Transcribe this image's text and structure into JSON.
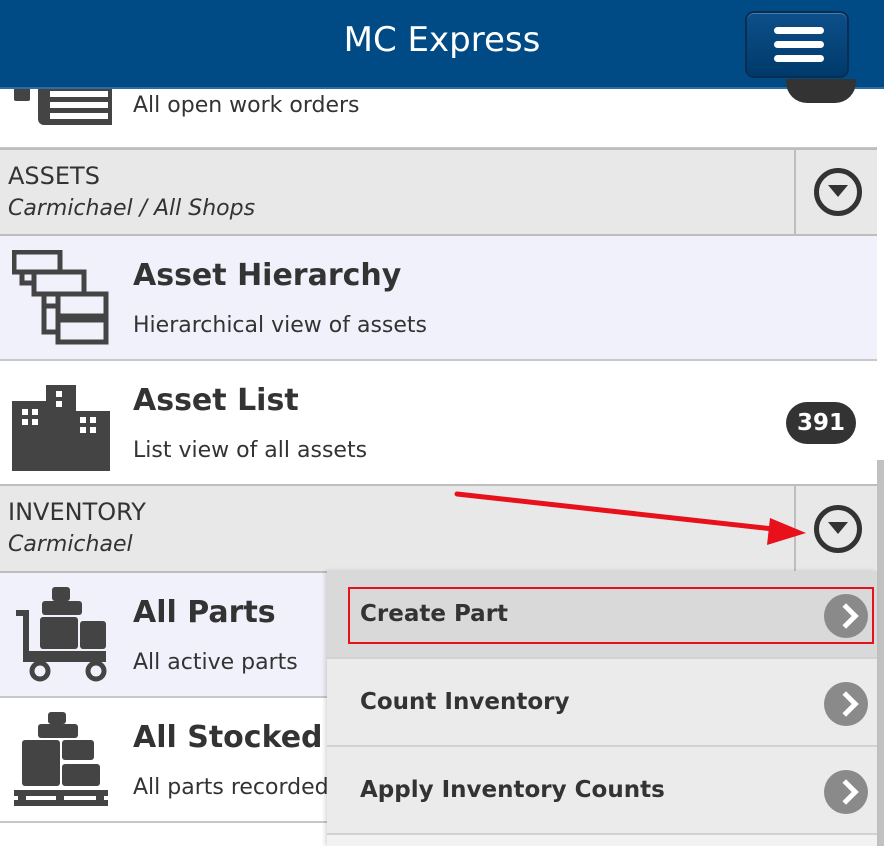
{
  "header": {
    "title": "MC Express"
  },
  "work_orders": {
    "desc": "All open work orders"
  },
  "assets_section": {
    "title": "ASSETS",
    "subtitle": "Carmichael / All Shops"
  },
  "asset_hierarchy": {
    "title": "Asset Hierarchy",
    "desc": "Hierarchical view of assets"
  },
  "asset_list": {
    "title": "Asset List",
    "desc": "List view of all assets",
    "count": "391"
  },
  "inventory_section": {
    "title": "INVENTORY",
    "subtitle": "Carmichael"
  },
  "all_parts": {
    "title": "All Parts",
    "desc": "All active parts"
  },
  "all_stocked": {
    "title": "All Stocked P",
    "desc": "All parts recorded"
  },
  "inventory_menu": [
    {
      "label": "Create Part"
    },
    {
      "label": "Count Inventory"
    },
    {
      "label": "Apply Inventory Counts"
    }
  ],
  "colors": {
    "header": "#004b86",
    "annotation": "#e8101a",
    "badge": "#333333"
  }
}
